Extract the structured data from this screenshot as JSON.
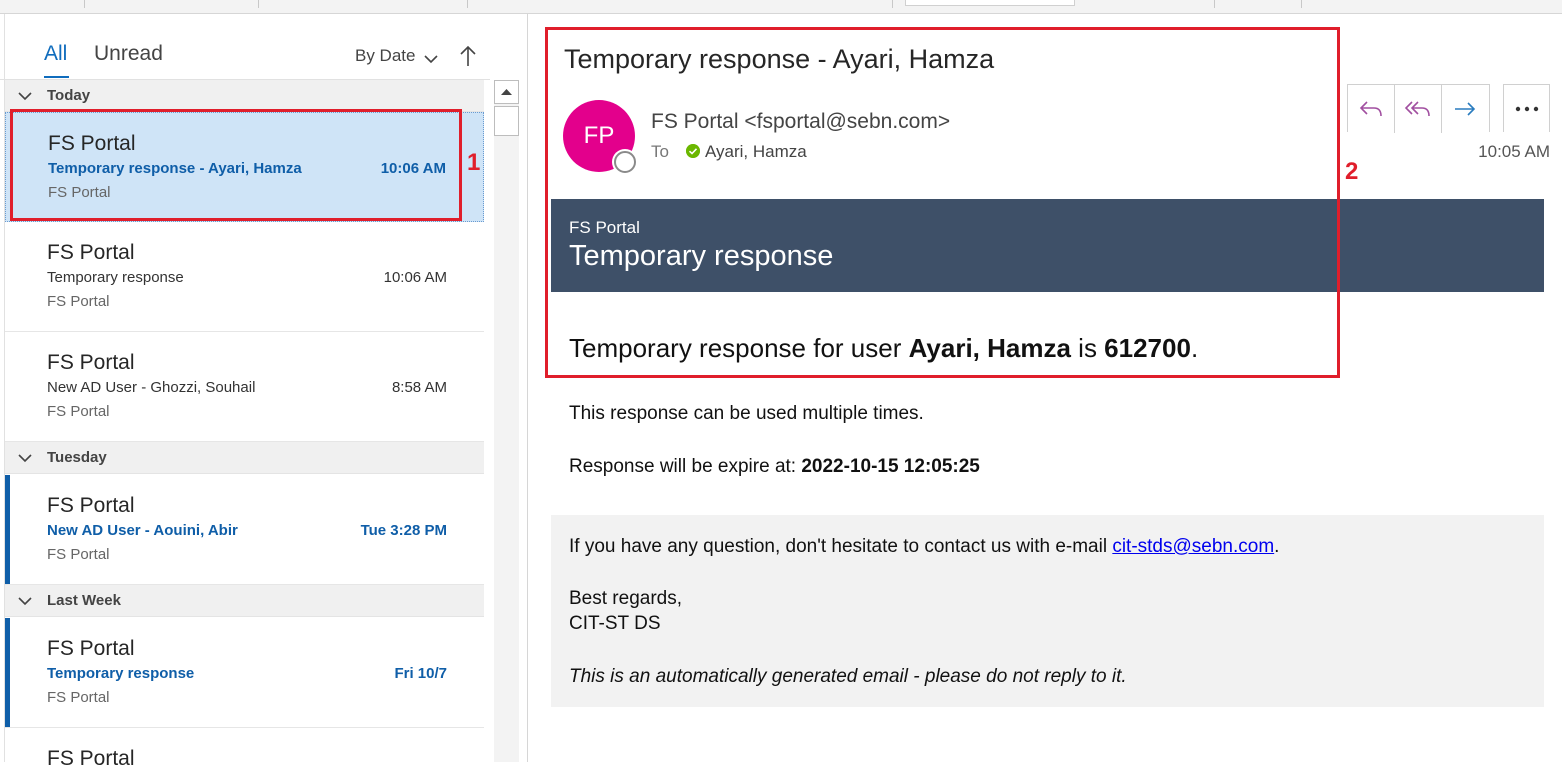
{
  "filters": {
    "all": "All",
    "unread": "Unread",
    "sort": "By Date"
  },
  "groups": [
    {
      "name": "Today"
    },
    {
      "name": "Tuesday"
    },
    {
      "name": "Last Week"
    }
  ],
  "messages": [
    {
      "sender": "FS Portal",
      "subject": "Temporary response - Ayari, Hamza",
      "time": "10:06 AM",
      "preview": "FS Portal"
    },
    {
      "sender": "FS Portal",
      "subject": "Temporary response",
      "time": "10:06 AM",
      "preview": "FS Portal"
    },
    {
      "sender": "FS Portal",
      "subject": "New AD User - Ghozzi, Souhail",
      "time": "8:58 AM",
      "preview": "FS Portal"
    },
    {
      "sender": "FS Portal",
      "subject": "New AD User - Aouini, Abir",
      "time": "Tue 3:28 PM",
      "preview": "FS Portal"
    },
    {
      "sender": "FS Portal",
      "subject": "Temporary response",
      "time": "Fri 10/7",
      "preview": "FS Portal"
    },
    {
      "sender": "FS Portal"
    }
  ],
  "reading": {
    "subject": "Temporary response - Ayari, Hamza",
    "avatar_initials": "FP",
    "from": "FS Portal <fsportal@sebn.com>",
    "to_label": "To",
    "to_name": "Ayari, Hamza",
    "time": "10:05 AM",
    "actions": [
      "reply-icon",
      "reply-all-icon",
      "forward-icon",
      "more-icon"
    ]
  },
  "email": {
    "banner_small": "FS Portal",
    "banner_title": "Temporary response",
    "main_prefix": "Temporary response for user ",
    "main_user": "Ayari, Hamza",
    "main_mid": " is ",
    "main_code": "612700",
    "main_suffix": ".",
    "multiple": "This response can be used multiple times.",
    "expire_prefix": "Response will be expire at: ",
    "expire_value": "2022-10-15 12:05:25",
    "contact_prefix": "If you have any question, don't hesitate to contact us with e-mail ",
    "contact_email": "cit-stds@sebn.com",
    "contact_suffix": ".",
    "regards": "Best regards,",
    "team": "CIT-ST DS",
    "auto_note": "This is an automatically generated email - please do not reply to it."
  },
  "annotations": {
    "first": "1",
    "second": "2"
  },
  "colors": {
    "accent": "#0f6cbd",
    "avatar": "#e3008c",
    "banner": "#3e5068",
    "annotation": "#e01e2b"
  }
}
